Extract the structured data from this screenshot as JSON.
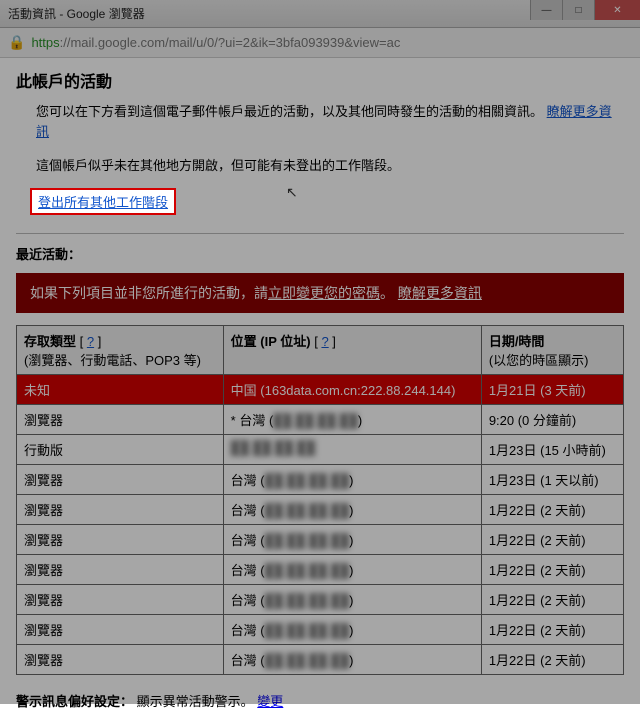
{
  "window": {
    "title": "活動資訊 - Google 瀏覽器",
    "min": "—",
    "max": "□",
    "close": "✕"
  },
  "address": {
    "lock": "🔒",
    "proto": "https",
    "rest": "://mail.google.com/mail/u/0/?ui=2&ik=3bfa093939&view=ac"
  },
  "page": {
    "title": "此帳戶的活動",
    "intro_prefix": "您可以在下方看到這個電子郵件帳戶最近的活動，以及其他同時發生的活動的相關資訊。",
    "intro_link": "瞭解更多資訊",
    "note": "這個帳戶似乎未在其他地方開啟，但可能有未登出的工作階段。",
    "signout": "登出所有其他工作階段",
    "recent_header": "最近活動："
  },
  "alert": {
    "prefix": "如果下列項目並非您所進行的活動，請",
    "link1": "立即變更您的密碼",
    "sep": "。",
    "link2": "瞭解更多資訊"
  },
  "table": {
    "headers": {
      "c1_main": "存取類型",
      "c1_help": "?",
      "c1_sub": "(瀏覽器、行動電話、POP3 等)",
      "c2_main": "位置 (IP 位址)",
      "c2_help": "?",
      "c3_main": "日期/時間",
      "c3_sub": "(以您的時區顯示)"
    },
    "rows": [
      {
        "type": "未知",
        "loc": "中国 (163data.com.cn:222.88.244.144)",
        "dt": "1月21日 (3 天前)",
        "highlight": true
      },
      {
        "type": "瀏覽器",
        "loc_prefix": "* 台灣 (",
        "loc_blur": "██.██.██.██",
        "loc_suffix": ")",
        "dt": "9:20 (0 分鐘前)"
      },
      {
        "type": "行動版",
        "loc_prefix": "",
        "loc_blur": "██.██.██.██",
        "loc_suffix": "",
        "dt": "1月23日 (15 小時前)"
      },
      {
        "type": "瀏覽器",
        "loc_prefix": "台灣 (",
        "loc_blur": "██.██.██.██",
        "loc_suffix": ")",
        "dt": "1月23日 (1 天以前)"
      },
      {
        "type": "瀏覽器",
        "loc_prefix": "台灣 (",
        "loc_blur": "██.██.██.██",
        "loc_suffix": ")",
        "dt": "1月22日 (2 天前)"
      },
      {
        "type": "瀏覽器",
        "loc_prefix": "台灣 (",
        "loc_blur": "██.██.██.██",
        "loc_suffix": ")",
        "dt": "1月22日 (2 天前)"
      },
      {
        "type": "瀏覽器",
        "loc_prefix": "台灣 (",
        "loc_blur": "██.██.██.██",
        "loc_suffix": ")",
        "dt": "1月22日 (2 天前)"
      },
      {
        "type": "瀏覽器",
        "loc_prefix": "台灣 (",
        "loc_blur": "██.██.██.██",
        "loc_suffix": ")",
        "dt": "1月22日 (2 天前)"
      },
      {
        "type": "瀏覽器",
        "loc_prefix": "台灣 (",
        "loc_blur": "██.██.██.██",
        "loc_suffix": ")",
        "dt": "1月22日 (2 天前)"
      },
      {
        "type": "瀏覽器",
        "loc_prefix": "台灣 (",
        "loc_blur": "██.██.██.██",
        "loc_suffix": ")",
        "dt": "1月22日 (2 天前)"
      }
    ]
  },
  "footer": {
    "label": "警示訊息偏好設定：",
    "text": "顯示異常活動警示。",
    "link": "變更"
  }
}
